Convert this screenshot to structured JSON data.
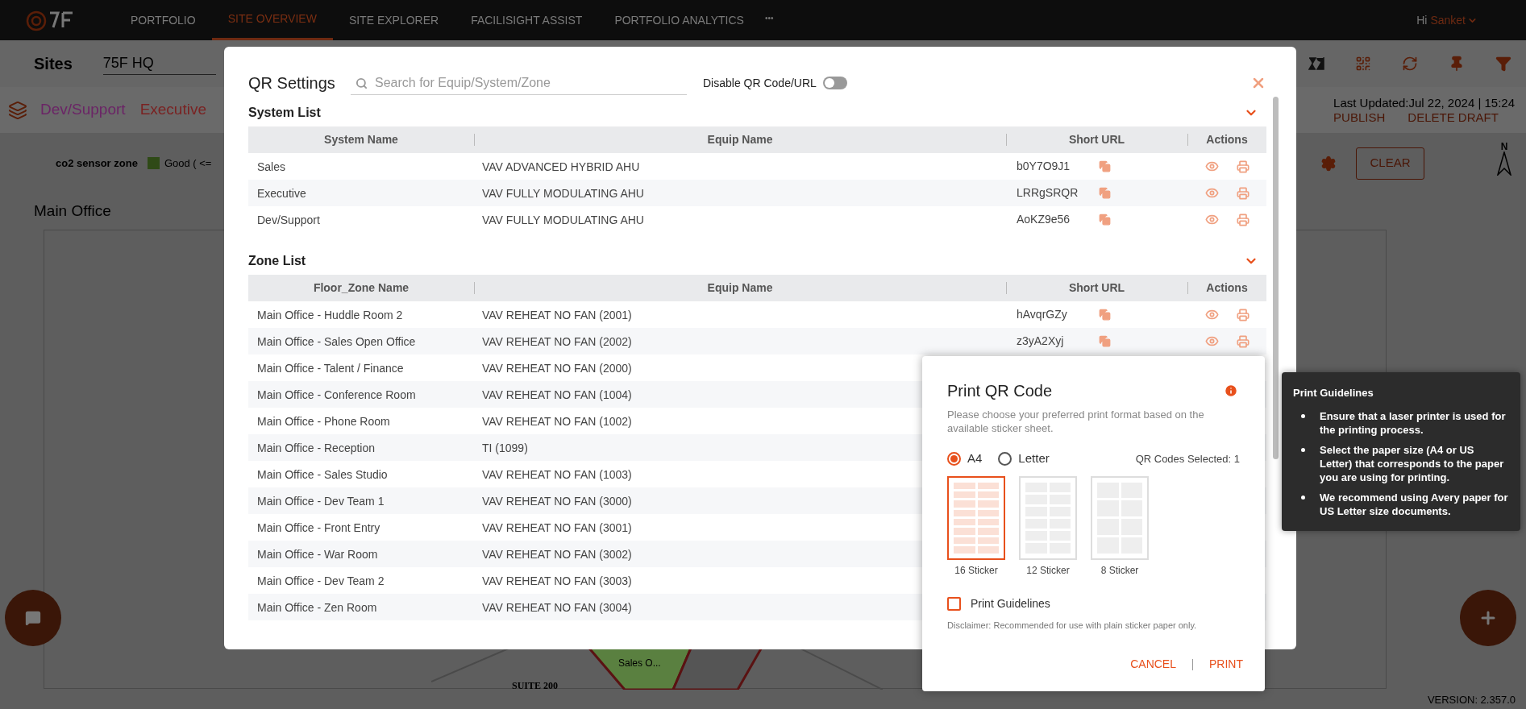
{
  "nav": {
    "tabs": [
      {
        "label": "PORTFOLIO",
        "selected": false
      },
      {
        "label": "SITE OVERVIEW",
        "selected": true
      },
      {
        "label": "SITE EXPLORER",
        "selected": false
      },
      {
        "label": "FACILISIGHT ASSIST",
        "selected": false
      },
      {
        "label": "PORTFOLIO ANALYTICS",
        "selected": false
      }
    ],
    "more": "•••",
    "greeting": "Hi",
    "user": "Sanket"
  },
  "site_bar": {
    "label": "Sites",
    "site": "75F HQ"
  },
  "system_tags": [
    {
      "label": "Dev/Support",
      "color": "#6b2466"
    },
    {
      "label": "Executive",
      "color": "#7a2222"
    }
  ],
  "status": {
    "last_updated": "Last Updated:Jul 22, 2024 | 15:24",
    "actions": [
      "PUBLISH",
      "DELETE DRAFT"
    ]
  },
  "legend": {
    "title": "co2 sensor zone",
    "items": [
      {
        "label": "Good ( <=",
        "color": "#2f4a17"
      }
    ]
  },
  "clear_button": "CLEAR",
  "compass": "N",
  "floor": {
    "title": "Main Office",
    "labels": [
      "Sales O...",
      "SUITE 200"
    ]
  },
  "version": "VERSION: 2.357.0",
  "qr_settings": {
    "title": "QR Settings",
    "search_placeholder": "Search for Equip/System/Zone",
    "disable_label": "Disable QR Code/URL",
    "disable_on": false,
    "system_list": {
      "title": "System List",
      "expanded": true,
      "columns": [
        "System Name",
        "Equip Name",
        "Short URL",
        "Actions"
      ],
      "rows": [
        {
          "name": "Sales",
          "equip": "VAV ADVANCED HYBRID AHU",
          "short_url": "b0Y7O9J1"
        },
        {
          "name": "Executive",
          "equip": "VAV FULLY MODULATING AHU",
          "short_url": "LRRgSRQR"
        },
        {
          "name": "Dev/Support",
          "equip": "VAV FULLY MODULATING AHU",
          "short_url": "AoKZ9e56"
        }
      ]
    },
    "zone_list": {
      "title": "Zone List",
      "expanded": true,
      "columns": [
        "Floor_Zone Name",
        "Equip Name",
        "Short URL",
        "Actions"
      ],
      "rows": [
        {
          "name": "Main Office - Huddle Room 2",
          "equip": "VAV REHEAT NO FAN (2001)",
          "short_url": "hAvqrGZy"
        },
        {
          "name": "Main Office - Sales Open Office",
          "equip": "VAV REHEAT NO FAN (2002)",
          "short_url": "z3yA2Xyj"
        },
        {
          "name": "Main Office - Talent / Finance",
          "equip": "VAV REHEAT NO FAN (2000)"
        },
        {
          "name": "Main Office - Conference Room",
          "equip": "VAV REHEAT NO FAN (1004)"
        },
        {
          "name": "Main Office - Phone Room",
          "equip": "VAV REHEAT NO FAN (1002)"
        },
        {
          "name": "Main Office - Reception",
          "equip": "TI (1099)"
        },
        {
          "name": "Main Office - Sales Studio",
          "equip": "VAV REHEAT NO FAN (1003)"
        },
        {
          "name": "Main Office - Dev Team 1",
          "equip": "VAV REHEAT NO FAN (3000)"
        },
        {
          "name": "Main Office - Front Entry",
          "equip": "VAV REHEAT NO FAN (3001)"
        },
        {
          "name": "Main Office - War Room",
          "equip": "VAV REHEAT NO FAN (3002)"
        },
        {
          "name": "Main Office - Dev Team 2",
          "equip": "VAV REHEAT NO FAN (3003)"
        },
        {
          "name": "Main Office - Zen Room",
          "equip": "VAV REHEAT NO FAN (3004)"
        }
      ]
    }
  },
  "print_dialog": {
    "title": "Print QR Code",
    "description": "Please choose your preferred print format based on the available sticker sheet.",
    "paper_sizes": [
      {
        "label": "A4",
        "selected": true
      },
      {
        "label": "Letter",
        "selected": false
      }
    ],
    "selected_count": "QR Codes Selected: 1",
    "stickers": [
      {
        "label": "16 Sticker",
        "selected": true
      },
      {
        "label": "12 Sticker",
        "selected": false
      },
      {
        "label": "8 Sticker",
        "selected": false
      }
    ],
    "guidelines_checkbox": {
      "label": "Print Guidelines",
      "checked": false
    },
    "disclaimer": "Disclaimer: Recommended for use with plain sticker paper only.",
    "buttons": [
      "CANCEL",
      "PRINT"
    ]
  },
  "tooltip": {
    "title": "Print Guidelines",
    "items": [
      "Ensure that a laser printer is used for the printing process.",
      "Select the paper size (A4 or US Letter) that corresponds to the paper you are using for printing.",
      "We recommend using Avery paper for US Letter size documents."
    ]
  }
}
